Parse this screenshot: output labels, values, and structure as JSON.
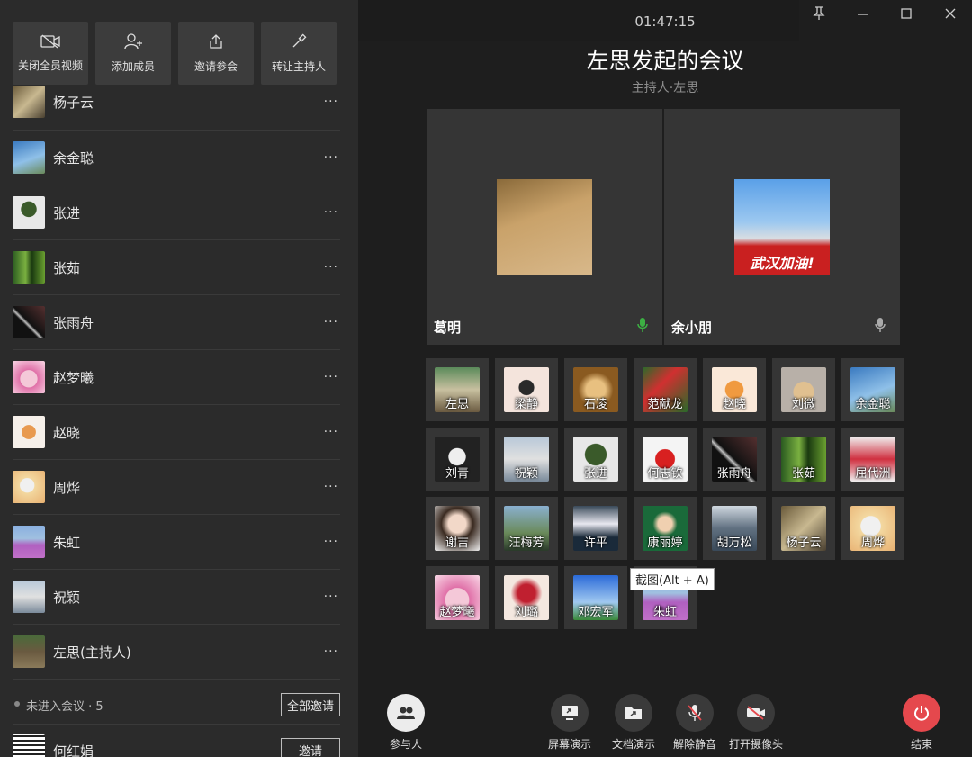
{
  "actions": [
    "关闭全员视频",
    "添加成员",
    "邀请参会",
    "转让主持人"
  ],
  "participants": [
    {
      "name": "杨子云"
    },
    {
      "name": "余金聪"
    },
    {
      "name": "张进"
    },
    {
      "name": "张茹"
    },
    {
      "name": "张雨舟"
    },
    {
      "name": "赵梦曦"
    },
    {
      "name": "赵晓"
    },
    {
      "name": "周烨"
    },
    {
      "name": "朱虹"
    },
    {
      "name": "祝颖"
    },
    {
      "name": "左思(主持人)"
    }
  ],
  "more_label": "···",
  "not_joined": {
    "label": "未进入会议 · 5",
    "invite_all": "全部邀请",
    "first_name": "何红娟",
    "invite": "邀请"
  },
  "timer": "01:47:15",
  "meeting_title": "左思发起的会议",
  "host_line": "主持人·左思",
  "videos": [
    {
      "name": "葛明",
      "mic": "active"
    },
    {
      "name": "余小朋",
      "mic": "idle",
      "badge": "武汉加油!"
    }
  ],
  "grid": [
    "左思",
    "梁静",
    "石凌",
    "范献龙",
    "赵晓",
    "刘微",
    "余金聪",
    "刘青",
    "祝颖",
    "张进",
    "何志钦",
    "张雨舟",
    "张茹",
    "屈代洲",
    "谢吉",
    "汪梅芳",
    "许平",
    "康丽婷",
    "胡万松",
    "杨子云",
    "周烨",
    "赵梦曦",
    "刘璐",
    "邓宏军",
    "朱虹"
  ],
  "tooltip": "截图(Alt + A)",
  "toolbar": {
    "participants": "参与人",
    "screen": "屏幕演示",
    "doc": "文档演示",
    "unmute": "解除静音",
    "camera": "打开摄像头",
    "end": "结束"
  },
  "colors": {
    "end": "#e5484d",
    "mic_active": "#3cb043",
    "panel": "#2b2b2b",
    "tile": "#353535"
  }
}
